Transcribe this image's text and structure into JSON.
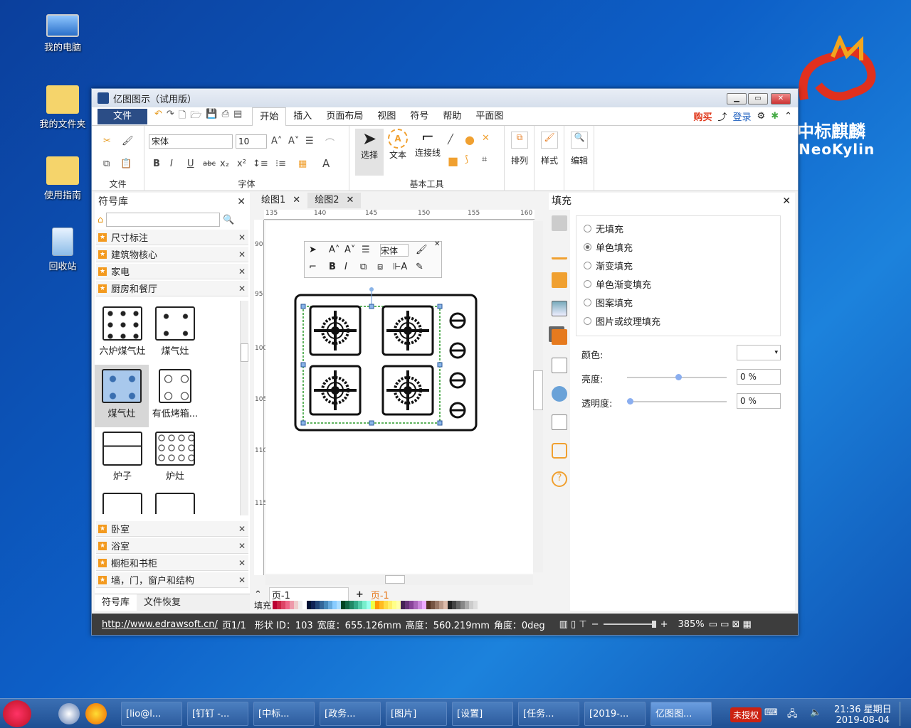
{
  "desktop": {
    "icons": [
      {
        "label": "我的电脑"
      },
      {
        "label": "我的文件夹"
      },
      {
        "label": "使用指南"
      },
      {
        "label": "回收站"
      }
    ],
    "logo_text": "中标麒麟",
    "logo_sub": "NeoKylin"
  },
  "window": {
    "title": "亿图图示（试用版）"
  },
  "menu": {
    "file": "文件",
    "tabs": [
      "开始",
      "插入",
      "页面布局",
      "视图",
      "符号",
      "帮助",
      "平面图"
    ],
    "buy": "购买",
    "login": "登录"
  },
  "ribbon": {
    "font_name": "宋体",
    "font_size": "10",
    "group_file": "文件",
    "group_font": "字体",
    "select": "选择",
    "text": "文本",
    "connector": "连接线",
    "group_basic": "基本工具",
    "arrange": "排列",
    "style": "样式",
    "edit": "编辑"
  },
  "library": {
    "title": "符号库",
    "categories_top": [
      "尺寸标注",
      "建筑物核心",
      "家电",
      "厨房和餐厅"
    ],
    "shapes": [
      "六炉煤气灶",
      "煤气灶",
      "煤气灶",
      "有低烤箱...",
      "炉子",
      "炉灶"
    ],
    "categories_bottom": [
      "卧室",
      "浴室",
      "橱柜和书柜",
      "墙，门，窗户和结构"
    ],
    "tabs": [
      "符号库",
      "文件恢复"
    ]
  },
  "canvas": {
    "tabs": [
      "绘图1",
      "绘图2"
    ],
    "ruler_h": [
      "135",
      "140",
      "145",
      "150",
      "155",
      "160"
    ],
    "ruler_v": [
      "90",
      "95",
      "100",
      "105",
      "110",
      "115"
    ],
    "page_name": "页-1",
    "page_tab": "页-1",
    "fill_label": "填充",
    "mini_font": "宋体"
  },
  "fill": {
    "title": "填充",
    "options": [
      "无填充",
      "单色填充",
      "渐变填充",
      "单色渐变填充",
      "图案填充",
      "图片或纹理填充"
    ],
    "selected": "单色填充",
    "color_label": "颜色:",
    "brightness_label": "亮度:",
    "brightness_value": "0 %",
    "transparency_label": "透明度:",
    "transparency_value": "0 %"
  },
  "status": {
    "url": "http://www.edrawsoft.cn/",
    "page": "页1/1",
    "shape_id": "形状 ID：103",
    "width": "宽度：655.126mm",
    "height": "高度：560.219mm",
    "angle": "角度：0deg",
    "zoom": "385%"
  },
  "taskbar": {
    "items": [
      "[lio@l...",
      "[钉钉 -...",
      "[中标...",
      "[政务...",
      "[图片]",
      "[设置]",
      "[任务...",
      "[2019-...",
      "亿图图..."
    ],
    "unauthorized": "未授权",
    "time": "21:36 星期日",
    "date": "2019-08-04"
  }
}
